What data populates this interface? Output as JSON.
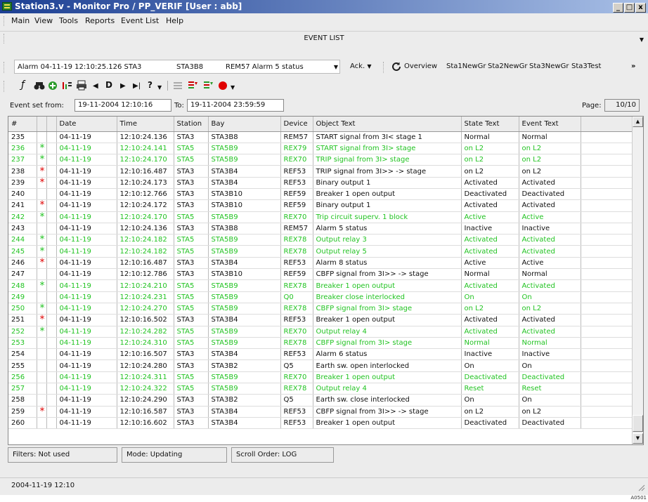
{
  "window": {
    "title": "Station3.v - Monitor Pro / PP_VERIF [User : abb]",
    "controls": {
      "minimize": "_",
      "maximize": "□",
      "close": "x"
    }
  },
  "menu": [
    "Main",
    "View",
    "Tools",
    "Reports",
    "Event List",
    "Help"
  ],
  "panel_title": "EVENT LIST",
  "alarm": {
    "text": "Alarm 04-11-19 12:10:25.126 STA3",
    "bay": "STA3B8",
    "desc": "REM57 Alarm 5 status"
  },
  "ack_label": "Ack.",
  "nav_links": [
    "Overview",
    "Sta1NewGr",
    "Sta2NewGr",
    "Sta3NewGr",
    "Sta3Test"
  ],
  "more_glyph": "»",
  "toolbar_glyphs": {
    "f": "ƒ",
    "bin": "🔍",
    "D": "D",
    "help": "?"
  },
  "event_set": {
    "from_label": "Event set from:",
    "from_value": "19-11-2004 12:10:16",
    "to_label": "To:",
    "to_value": "19-11-2004 23:59:59",
    "page_label": "Page:",
    "page_value": "10/10"
  },
  "columns": [
    "#",
    "",
    "",
    "Date",
    "Time",
    "Station",
    "Bay",
    "Device",
    "Object Text",
    "State Text",
    "Event Text"
  ],
  "rows": [
    {
      "n": "235",
      "mark": "",
      "date": "04-11-19",
      "time": "12:10:24.136",
      "station": "STA3",
      "bay": "STA3B8",
      "device": "REM57",
      "object": "START signal from 3I< stage 1",
      "state": "Normal",
      "event": "Normal",
      "green": false
    },
    {
      "n": "236",
      "mark": "*",
      "date": "04-11-19",
      "time": "12:10:24.141",
      "station": "STA5",
      "bay": "STA5B9",
      "device": "REX79",
      "object": "START signal from 3I> stage",
      "state": "on L2",
      "event": "on L2",
      "green": true
    },
    {
      "n": "237",
      "mark": "*",
      "date": "04-11-19",
      "time": "12:10:24.170",
      "station": "STA5",
      "bay": "STA5B9",
      "device": "REX70",
      "object": "TRIP signal from 3I> stage",
      "state": "on L2",
      "event": "on L2",
      "green": true
    },
    {
      "n": "238",
      "mark": "*",
      "date": "04-11-19",
      "time": "12:10:16.487",
      "station": "STA3",
      "bay": "STA3B4",
      "device": "REF53",
      "object": "TRIP signal from 3I>> -> stage",
      "state": "on L2",
      "event": "on L2",
      "green": false
    },
    {
      "n": "239",
      "mark": "*",
      "date": "04-11-19",
      "time": "12:10:24.173",
      "station": "STA3",
      "bay": "STA3B4",
      "device": "REF53",
      "object": "Binary output 1",
      "state": "Activated",
      "event": "Activated",
      "green": false
    },
    {
      "n": "240",
      "mark": "",
      "date": "04-11-19",
      "time": "12:10:12.766",
      "station": "STA3",
      "bay": "STA3B10",
      "device": "REF59",
      "object": "Breaker 1 open output",
      "state": "Deactivated",
      "event": "Deactivated",
      "green": false
    },
    {
      "n": "241",
      "mark": "*",
      "date": "04-11-19",
      "time": "12:10:24.172",
      "station": "STA3",
      "bay": "STA3B10",
      "device": "REF59",
      "object": "Binary output 1",
      "state": "Activated",
      "event": "Activated",
      "green": false
    },
    {
      "n": "242",
      "mark": "*",
      "date": "04-11-19",
      "time": "12:10:24.170",
      "station": "STA5",
      "bay": "STA5B9",
      "device": "REX70",
      "object": "Trip circuit superv. 1 block",
      "state": "Active",
      "event": "Active",
      "green": true
    },
    {
      "n": "243",
      "mark": "",
      "date": "04-11-19",
      "time": "12:10:24.136",
      "station": "STA3",
      "bay": "STA3B8",
      "device": "REM57",
      "object": "Alarm 5 status",
      "state": "Inactive",
      "event": "Inactive",
      "green": false
    },
    {
      "n": "244",
      "mark": "*",
      "date": "04-11-19",
      "time": "12:10:24.182",
      "station": "STA5",
      "bay": "STA5B9",
      "device": "REX78",
      "object": "Output relay 3",
      "state": "Activated",
      "event": "Activated",
      "green": true
    },
    {
      "n": "245",
      "mark": "*",
      "date": "04-11-19",
      "time": "12:10:24.182",
      "station": "STA5",
      "bay": "STA5B9",
      "device": "REX78",
      "object": "Output relay 5",
      "state": "Activated",
      "event": "Activated",
      "green": true
    },
    {
      "n": "246",
      "mark": "*",
      "date": "04-11-19",
      "time": "12:10:16.487",
      "station": "STA3",
      "bay": "STA3B4",
      "device": "REF53",
      "object": "Alarm 8 status",
      "state": "Active",
      "event": "Active",
      "green": false
    },
    {
      "n": "247",
      "mark": "",
      "date": "04-11-19",
      "time": "12:10:12.786",
      "station": "STA3",
      "bay": "STA3B10",
      "device": "REF59",
      "object": "CBFP signal from 3I>> -> stage",
      "state": "Normal",
      "event": "Normal",
      "green": false
    },
    {
      "n": "248",
      "mark": "*",
      "date": "04-11-19",
      "time": "12:10:24.210",
      "station": "STA5",
      "bay": "STA5B9",
      "device": "REX78",
      "object": "Breaker 1 open output",
      "state": "Activated",
      "event": "Activated",
      "green": true
    },
    {
      "n": "249",
      "mark": "",
      "date": "04-11-19",
      "time": "12:10:24.231",
      "station": "STA5",
      "bay": "STA5B9",
      "device": "Q0",
      "object": "Breaker close interlocked",
      "state": "On",
      "event": "On",
      "green": true
    },
    {
      "n": "250",
      "mark": "*",
      "date": "04-11-19",
      "time": "12:10:24.270",
      "station": "STA5",
      "bay": "STA5B9",
      "device": "REX78",
      "object": "CBFP signal from 3I> stage",
      "state": "on L2",
      "event": "on L2",
      "green": true
    },
    {
      "n": "251",
      "mark": "*",
      "date": "04-11-19",
      "time": "12:10:16.502",
      "station": "STA3",
      "bay": "STA3B4",
      "device": "REF53",
      "object": "Breaker 1 open output",
      "state": "Activated",
      "event": "Activated",
      "green": false
    },
    {
      "n": "252",
      "mark": "*",
      "date": "04-11-19",
      "time": "12:10:24.282",
      "station": "STA5",
      "bay": "STA5B9",
      "device": "REX70",
      "object": "Output relay 4",
      "state": "Activated",
      "event": "Activated",
      "green": true
    },
    {
      "n": "253",
      "mark": "",
      "date": "04-11-19",
      "time": "12:10:24.310",
      "station": "STA5",
      "bay": "STA5B9",
      "device": "REX78",
      "object": "CBFP signal from 3I> stage",
      "state": "Normal",
      "event": "Normal",
      "green": true
    },
    {
      "n": "254",
      "mark": "",
      "date": "04-11-19",
      "time": "12:10:16.507",
      "station": "STA3",
      "bay": "STA3B4",
      "device": "REF53",
      "object": "Alarm 6 status",
      "state": "Inactive",
      "event": "Inactive",
      "green": false
    },
    {
      "n": "255",
      "mark": "",
      "date": "04-11-19",
      "time": "12:10:24.280",
      "station": "STA3",
      "bay": "STA3B2",
      "device": "Q5",
      "object": "Earth sw. open interlocked",
      "state": "On",
      "event": "On",
      "green": false
    },
    {
      "n": "256",
      "mark": "",
      "date": "04-11-19",
      "time": "12:10:24.311",
      "station": "STA5",
      "bay": "STA5B9",
      "device": "REX70",
      "object": "Breaker 1 open output",
      "state": "Deactivated",
      "event": "Deactivated",
      "green": true
    },
    {
      "n": "257",
      "mark": "",
      "date": "04-11-19",
      "time": "12:10:24.322",
      "station": "STA5",
      "bay": "STA5B9",
      "device": "REX78",
      "object": "Output relay 4",
      "state": "Reset",
      "event": "Reset",
      "green": true
    },
    {
      "n": "258",
      "mark": "",
      "date": "04-11-19",
      "time": "12:10:24.290",
      "station": "STA3",
      "bay": "STA3B2",
      "device": "Q5",
      "object": "Earth sw. close interlocked",
      "state": "On",
      "event": "On",
      "green": false
    },
    {
      "n": "259",
      "mark": "*",
      "date": "04-11-19",
      "time": "12:10:16.587",
      "station": "STA3",
      "bay": "STA3B4",
      "device": "REF53",
      "object": "CBFP signal from 3I>> -> stage",
      "state": "on L2",
      "event": "on L2",
      "green": false
    },
    {
      "n": "260",
      "mark": "",
      "date": "04-11-19",
      "time": "12:10:16.602",
      "station": "STA3",
      "bay": "STA3B4",
      "device": "REF53",
      "object": "Breaker 1 open output",
      "state": "Deactivated",
      "event": "Deactivated",
      "green": false
    }
  ],
  "status": {
    "filters": "Filters: Not used",
    "mode": "Mode: Updating",
    "scroll_order": "Scroll Order: LOG"
  },
  "bottom_status": "2004-11-19 12:10",
  "figure_code": "A0501",
  "colors": {
    "green_row": "#22c322",
    "alarm_mark": "#e00000",
    "title_bar": "#1c3f93"
  }
}
